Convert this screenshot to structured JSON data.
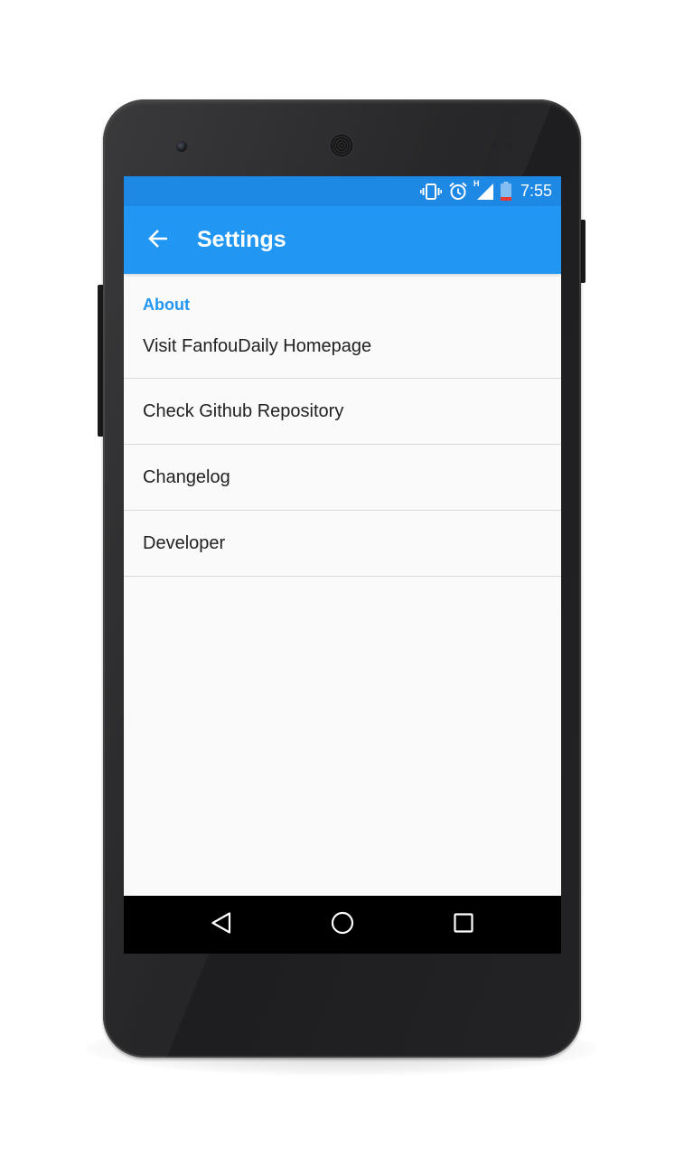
{
  "status_bar": {
    "time": "7:55",
    "network_label": "H",
    "icons": [
      "vibrate-icon",
      "alarm-icon",
      "signal-icon",
      "battery-low-icon"
    ]
  },
  "app_bar": {
    "title": "Settings",
    "back_icon": "arrow-back-icon"
  },
  "settings": {
    "section_title": "About",
    "items": [
      {
        "label": "Visit FanfouDaily Homepage"
      },
      {
        "label": "Check Github Repository"
      },
      {
        "label": "Changelog"
      },
      {
        "label": "Developer"
      }
    ]
  },
  "nav_bar": {
    "icons": [
      "nav-back-icon",
      "nav-home-icon",
      "nav-recents-icon"
    ]
  },
  "colors": {
    "status_bar": "#1e88e5",
    "app_bar": "#2196f3",
    "accent": "#2196f3",
    "background": "#fafafa",
    "battery_low": "#e53935"
  }
}
